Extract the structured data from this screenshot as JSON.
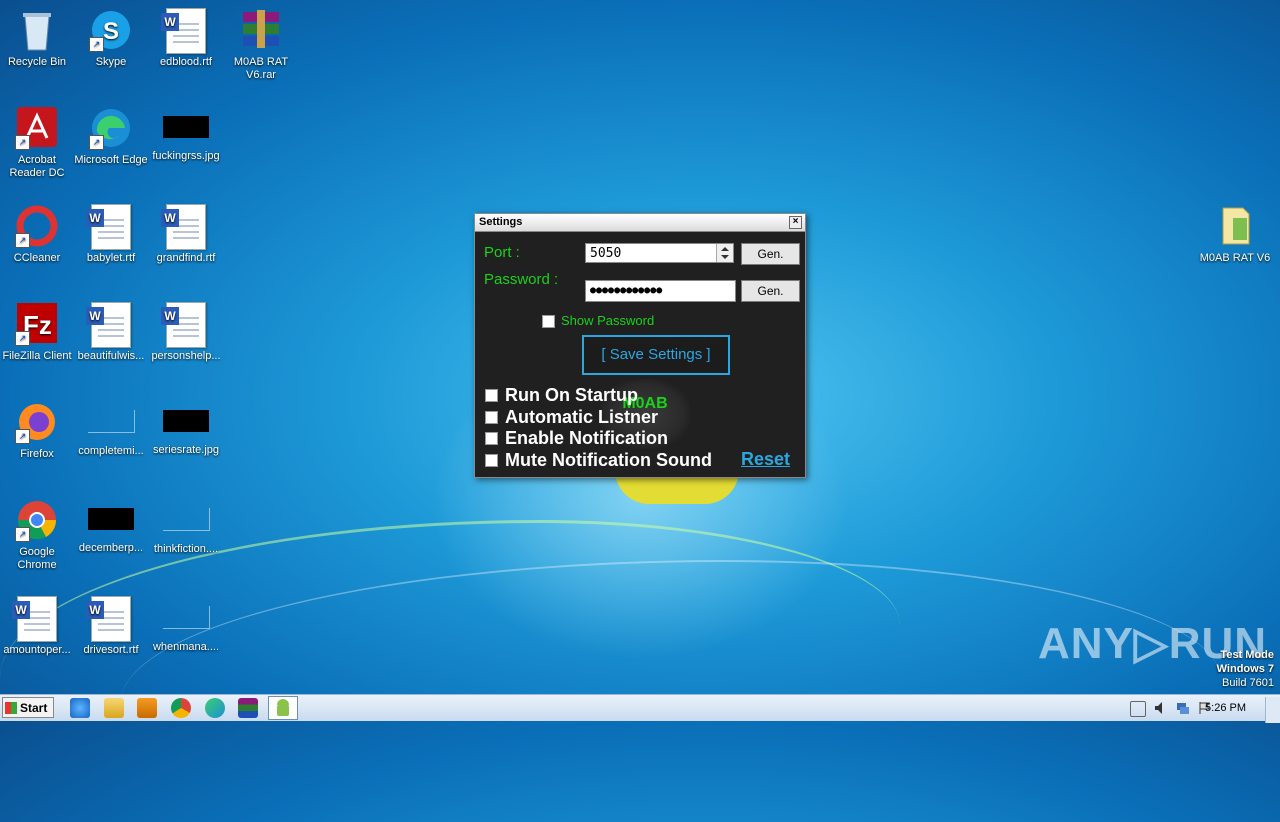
{
  "desktop": {
    "icons": [
      {
        "label": "Recycle Bin"
      },
      {
        "label": "Skype"
      },
      {
        "label": "edblood.rtf"
      },
      {
        "label": "M0AB RAT V6.rar"
      },
      {
        "label": "Acrobat Reader DC"
      },
      {
        "label": "Microsoft Edge"
      },
      {
        "label": "fuckingrss.jpg"
      },
      {
        "label": "CCleaner"
      },
      {
        "label": "babylet.rtf"
      },
      {
        "label": "grandfind.rtf"
      },
      {
        "label": "FileZilla Client"
      },
      {
        "label": "beautifulwis..."
      },
      {
        "label": "personshelp..."
      },
      {
        "label": "Firefox"
      },
      {
        "label": "completemi..."
      },
      {
        "label": "seriesrate.jpg"
      },
      {
        "label": "Google Chrome"
      },
      {
        "label": "decemberp..."
      },
      {
        "label": "thinkfiction...."
      },
      {
        "label": "amountoper..."
      },
      {
        "label": "drivesort.rtf"
      },
      {
        "label": "whenmana...."
      },
      {
        "label": "M0AB RAT V6"
      }
    ]
  },
  "settings_window": {
    "title": "Settings",
    "close_glyph": "×",
    "port_label": "Port :",
    "port_value": "5050",
    "password_label": "Password :",
    "password_value": "●●●●●●●●●●●●",
    "gen_label": "Gen.",
    "show_password_label": "Show Password",
    "save_label": "[ Save Settings ]",
    "logo_text": "M0AB",
    "options": [
      {
        "label": "Run On Startup"
      },
      {
        "label": "Automatic Listner"
      },
      {
        "label": "Enable Notification"
      },
      {
        "label": "Mute Notification Sound"
      }
    ],
    "reset_label": "Reset"
  },
  "watermark": {
    "text": "ANY▷RUN"
  },
  "test_mode": {
    "line1": "Test Mode",
    "line2": "Windows 7",
    "line3": "Build 7601"
  },
  "taskbar": {
    "start_label": "Start",
    "clock": "5:26 PM"
  }
}
